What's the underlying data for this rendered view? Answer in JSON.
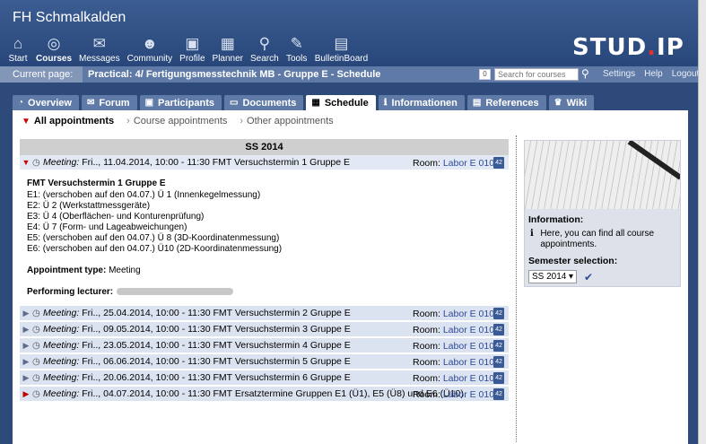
{
  "site_title": "FH Schmalkalden",
  "nav": [
    {
      "label": "Start",
      "icon": "home-icon",
      "glyph": "⌂"
    },
    {
      "label": "Courses",
      "icon": "courses-icon",
      "glyph": "◎",
      "active": true
    },
    {
      "label": "Messages",
      "icon": "messages-icon",
      "glyph": "✉"
    },
    {
      "label": "Community",
      "icon": "community-icon",
      "glyph": "☻"
    },
    {
      "label": "Profile",
      "icon": "profile-icon",
      "glyph": "▣"
    },
    {
      "label": "Planner",
      "icon": "planner-icon",
      "glyph": "▦"
    },
    {
      "label": "Search",
      "icon": "search-icon",
      "glyph": "⚲"
    },
    {
      "label": "Tools",
      "icon": "tools-icon",
      "glyph": "✎"
    },
    {
      "label": "BulletinBoard",
      "icon": "bulletin-board-icon",
      "glyph": "▤"
    }
  ],
  "logo": {
    "text_a": "STUD",
    "dot": ".",
    "text_b": "IP"
  },
  "breadcrumb": {
    "label": "Current page:",
    "title": "Practical: 4/ Fertigungsmesstechnik MB - Gruppe E - Schedule",
    "badge": "0",
    "search_placeholder": "Search for courses",
    "links": [
      "Settings",
      "Help",
      "Logout"
    ]
  },
  "tabs": [
    {
      "label": "Overview",
      "glyph": "◔"
    },
    {
      "label": "Forum",
      "glyph": "✉"
    },
    {
      "label": "Participants",
      "glyph": "▣"
    },
    {
      "label": "Documents",
      "glyph": "▭"
    },
    {
      "label": "Schedule",
      "glyph": "▦",
      "active": true
    },
    {
      "label": "Informationen",
      "glyph": "ℹ"
    },
    {
      "label": "References",
      "glyph": "▤"
    },
    {
      "label": "Wiki",
      "glyph": "♛"
    }
  ],
  "subnav": [
    "All appointments",
    "Course appointments",
    "Other appointments"
  ],
  "semester_header": "SS 2014",
  "appointments": [
    {
      "type": "Meeting:",
      "text": " Fri.., 11.04.2014, 10:00 - 11:30 FMT Versuchstermin 1 Gruppe E",
      "room_label": "Room: ",
      "room": "Labor E 0104",
      "open": true
    },
    {
      "type": "Meeting:",
      "text": " Fri.., 25.04.2014, 10:00 - 11:30 FMT Versuchstermin 2 Gruppe E",
      "room_label": "Room: ",
      "room": "Labor E 0104"
    },
    {
      "type": "Meeting:",
      "text": " Fri.., 09.05.2014, 10:00 - 11:30 FMT Versuchstermin 3 Gruppe E",
      "room_label": "Room: ",
      "room": "Labor E 0104"
    },
    {
      "type": "Meeting:",
      "text": " Fri.., 23.05.2014, 10:00 - 11:30 FMT Versuchstermin 4 Gruppe E",
      "room_label": "Room: ",
      "room": "Labor E 0104"
    },
    {
      "type": "Meeting:",
      "text": " Fri.., 06.06.2014, 10:00 - 11:30 FMT Versuchstermin 5 Gruppe E",
      "room_label": "Room: ",
      "room": "Labor E 0104"
    },
    {
      "type": "Meeting:",
      "text": " Fri.., 20.06.2014, 10:00 - 11:30 FMT Versuchstermin 6 Gruppe E",
      "room_label": "Room: ",
      "room": "Labor E 0104"
    },
    {
      "type": "Meeting:",
      "text": " Fri.., 04.07.2014, 10:00 - 11:30 FMT Ersatztermine Gruppen E1 (Ü1), E5 (Ü8) und E6 (Ü10)",
      "room_label": "Room: ",
      "room": "Labor E 0104",
      "highlight": true
    }
  ],
  "calendar_glyph": "42",
  "details": {
    "heading": "FMT Versuchstermin 1 Gruppe E",
    "lines": [
      "E1: (verschoben auf den 04.07.) Ü 1 (Innenkegelmessung)",
      "E2: Ü 2 (Werkstattmessgeräte)",
      "E3: Ü 4 (Oberflächen- und Konturenprüfung)",
      "E4: Ü 7 (Form- und Lageabweichungen)",
      "E5: (verschoben auf den 04.07.) Ü 8 (3D-Koordinatenmessung)",
      "E6: (verschoben auf den 04.07.) Ü10 (2D-Koordinatenmessung)"
    ],
    "type_label": "Appointment type:",
    "type_value": " Meeting",
    "lecturer_label": "Performing lecturer:"
  },
  "sidebar": {
    "info_heading": "Information:",
    "info_text": "Here, you can find all course appointments.",
    "semester_heading": "Semester selection:",
    "semester_value": "SS 2014"
  }
}
